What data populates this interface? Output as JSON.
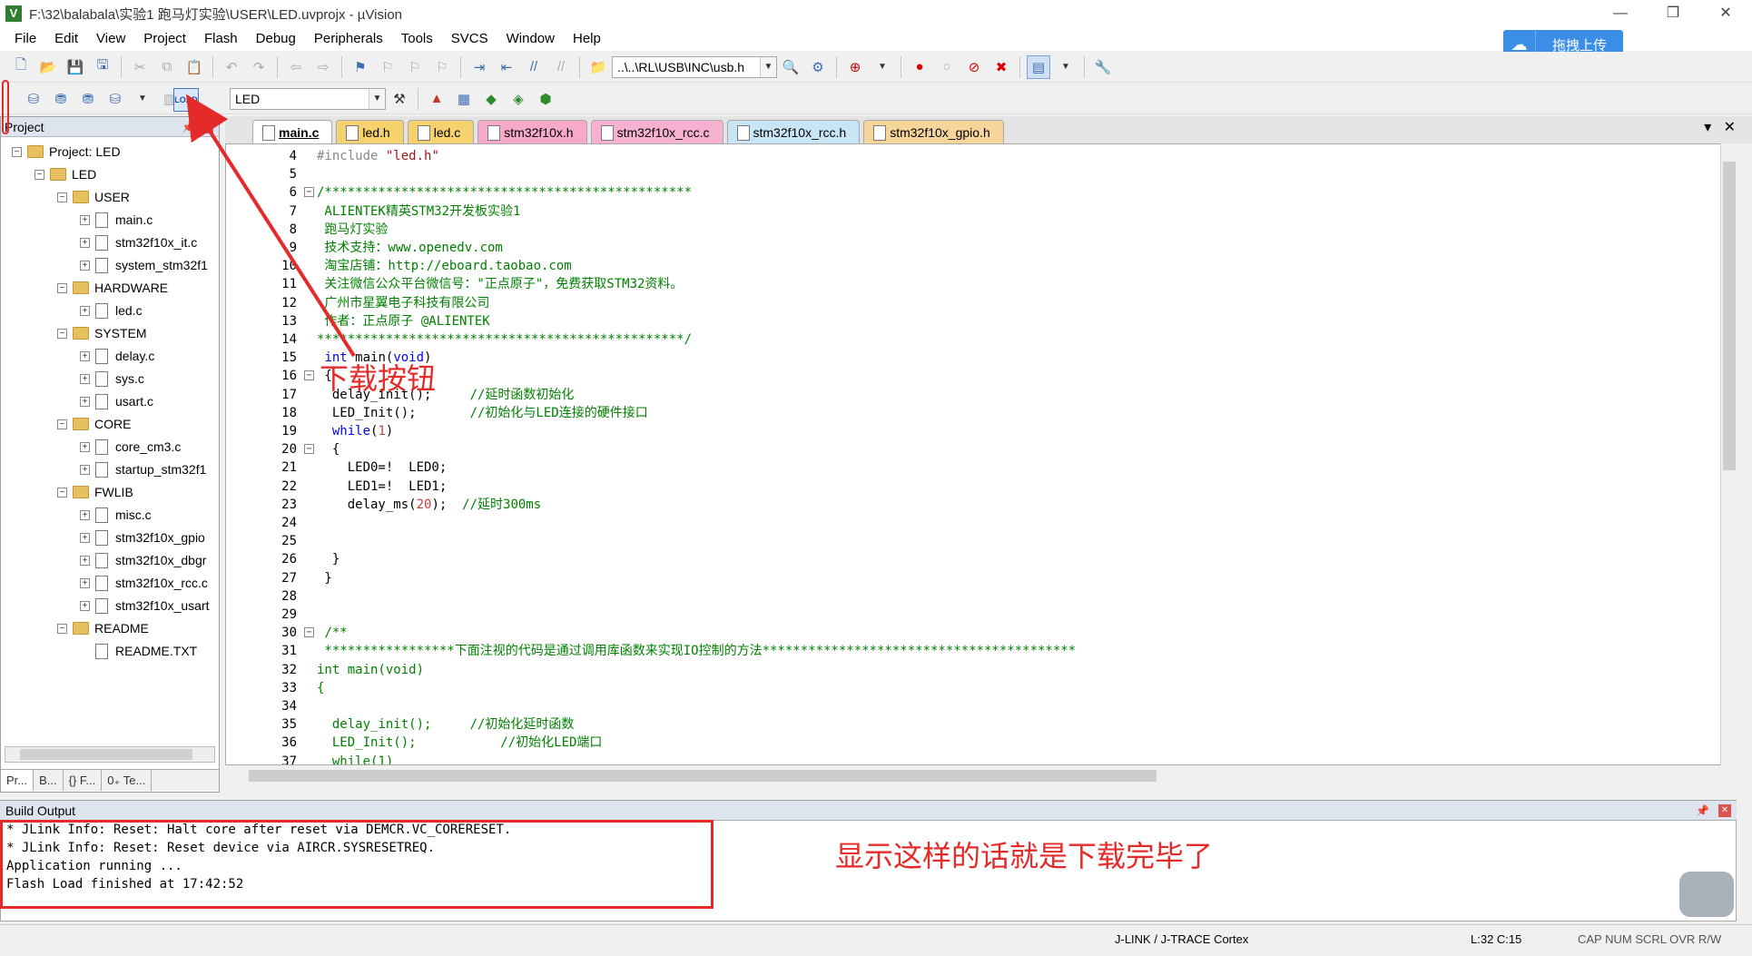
{
  "window": {
    "title": "F:\\32\\balabala\\实验1 跑马灯实验\\USER\\LED.uvprojx - µVision",
    "controls": [
      "—",
      "❐",
      "✕"
    ]
  },
  "menu": [
    "File",
    "Edit",
    "View",
    "Project",
    "Flash",
    "Debug",
    "Peripherals",
    "Tools",
    "SVCS",
    "Window",
    "Help"
  ],
  "cloud_upload": {
    "label": "拖拽上传"
  },
  "toolbar": {
    "file_combo": "..\\..\\RL\\USB\\INC\\usb.h",
    "target_combo": "LED",
    "load_label": "LOAD"
  },
  "project_panel": {
    "title": "Project",
    "tree": [
      {
        "label": "Project: LED",
        "level": 0,
        "type": "root"
      },
      {
        "label": "LED",
        "level": 1,
        "type": "target"
      },
      {
        "label": "USER",
        "level": 2,
        "type": "folder"
      },
      {
        "label": "main.c",
        "level": 3,
        "type": "file"
      },
      {
        "label": "stm32f10x_it.c",
        "level": 3,
        "type": "file"
      },
      {
        "label": "system_stm32f1",
        "level": 3,
        "type": "file"
      },
      {
        "label": "HARDWARE",
        "level": 2,
        "type": "folder"
      },
      {
        "label": "led.c",
        "level": 3,
        "type": "file"
      },
      {
        "label": "SYSTEM",
        "level": 2,
        "type": "folder"
      },
      {
        "label": "delay.c",
        "level": 3,
        "type": "file"
      },
      {
        "label": "sys.c",
        "level": 3,
        "type": "file"
      },
      {
        "label": "usart.c",
        "level": 3,
        "type": "file"
      },
      {
        "label": "CORE",
        "level": 2,
        "type": "folder"
      },
      {
        "label": "core_cm3.c",
        "level": 3,
        "type": "file"
      },
      {
        "label": "startup_stm32f1",
        "level": 3,
        "type": "file"
      },
      {
        "label": "FWLIB",
        "level": 2,
        "type": "folder"
      },
      {
        "label": "misc.c",
        "level": 3,
        "type": "file"
      },
      {
        "label": "stm32f10x_gpio",
        "level": 3,
        "type": "file"
      },
      {
        "label": "stm32f10x_dbgr",
        "level": 3,
        "type": "file"
      },
      {
        "label": "stm32f10x_rcc.c",
        "level": 3,
        "type": "file"
      },
      {
        "label": "stm32f10x_usart",
        "level": 3,
        "type": "file"
      },
      {
        "label": "README",
        "level": 2,
        "type": "folder"
      },
      {
        "label": "README.TXT",
        "level": 3,
        "type": "file"
      }
    ],
    "tabs": [
      "Pr...",
      "B...",
      "{} F...",
      "0₊ Te..."
    ]
  },
  "editor_tabs": [
    {
      "label": "main.c",
      "active": true,
      "color": ""
    },
    {
      "label": "led.h",
      "active": false,
      "color": "#f5d26d"
    },
    {
      "label": "led.c",
      "active": false,
      "color": "#f5d26d"
    },
    {
      "label": "stm32f10x.h",
      "active": false,
      "color": "#f7a9c9"
    },
    {
      "label": "stm32f10x_rcc.c",
      "active": false,
      "color": "#f7b1d0"
    },
    {
      "label": "stm32f10x_rcc.h",
      "active": false,
      "color": "#c8e5f5"
    },
    {
      "label": "stm32f10x_gpio.h",
      "active": false,
      "color": "#f5d59a"
    }
  ],
  "code_lines": [
    {
      "n": "4",
      "fold": "",
      "html": "<span class=\"pp\">#include</span> <span class=\"str\">\"led.h\"</span>"
    },
    {
      "n": "5",
      "fold": "",
      "html": ""
    },
    {
      "n": "6",
      "fold": "-",
      "html": "<span class=\"cm\">/************************************************</span>"
    },
    {
      "n": "7",
      "fold": "",
      "html": "<span class=\"cm\"> ALIENTEK精英STM32开发板实验1</span>"
    },
    {
      "n": "8",
      "fold": "",
      "html": "<span class=\"cm\"> 跑马灯实验</span>"
    },
    {
      "n": "9",
      "fold": "",
      "html": "<span class=\"cm\"> 技术支持：www.openedv.com</span>"
    },
    {
      "n": "10",
      "fold": "",
      "html": "<span class=\"cm\"> 淘宝店铺：http://eboard.taobao.com</span>"
    },
    {
      "n": "11",
      "fold": "",
      "html": "<span class=\"cm\"> 关注微信公众平台微信号：\"正点原子\"，免费获取STM32资料。</span>"
    },
    {
      "n": "12",
      "fold": "",
      "html": "<span class=\"cm\"> 广州市星翼电子科技有限公司</span>"
    },
    {
      "n": "13",
      "fold": "",
      "html": "<span class=\"cm\"> 作者：正点原子 @ALIENTEK</span>"
    },
    {
      "n": "14",
      "fold": "",
      "html": "<span class=\"cm\">************************************************/</span>"
    },
    {
      "n": "15",
      "fold": "",
      "html": " <span class=\"kw\">int</span> main(<span class=\"kw\">void</span>)"
    },
    {
      "n": "16",
      "fold": "-",
      "html": " {"
    },
    {
      "n": "17",
      "fold": "",
      "html": "  delay_init();     <span class=\"cm\">//延时函数初始化</span>"
    },
    {
      "n": "18",
      "fold": "",
      "html": "  LED_Init();       <span class=\"cm\">//初始化与LED连接的硬件接口</span>"
    },
    {
      "n": "19",
      "fold": "",
      "html": "  <span class=\"kw\">while</span>(<span class=\"num\">1</span>)"
    },
    {
      "n": "20",
      "fold": "-",
      "html": "  {"
    },
    {
      "n": "21",
      "fold": "",
      "html": "    LED0=!  LED0;"
    },
    {
      "n": "22",
      "fold": "",
      "html": "    LED1=!  LED1;"
    },
    {
      "n": "23",
      "fold": "",
      "html": "    delay_ms(<span class=\"num\">20</span>);  <span class=\"cm\">//延时300ms</span>"
    },
    {
      "n": "24",
      "fold": "",
      "html": ""
    },
    {
      "n": "25",
      "fold": "",
      "html": ""
    },
    {
      "n": "26",
      "fold": "",
      "html": "  }"
    },
    {
      "n": "27",
      "fold": "",
      "html": " }"
    },
    {
      "n": "28",
      "fold": "",
      "html": ""
    },
    {
      "n": "29",
      "fold": "",
      "html": ""
    },
    {
      "n": "30",
      "fold": "-",
      "html": " <span class=\"cm\">/**</span>"
    },
    {
      "n": "31",
      "fold": "",
      "html": "<span class=\"cm\"> *****************下面注视的代码是通过调用库函数来实现IO控制的方法*****************************************</span>"
    },
    {
      "n": "32",
      "fold": "",
      "html": "<span class=\"cm\">int main(void)</span>"
    },
    {
      "n": "33",
      "fold": "",
      "html": "<span class=\"cm\">{</span>"
    },
    {
      "n": "34",
      "fold": "",
      "html": ""
    },
    {
      "n": "35",
      "fold": "",
      "html": "<span class=\"cm\">  delay_init();     //初始化延时函数</span>"
    },
    {
      "n": "36",
      "fold": "",
      "html": "<span class=\"cm\">  LED_Init();           //初始化LED端口</span>"
    },
    {
      "n": "37",
      "fold": "",
      "html": "<span class=\"cm\">  while(1)</span>"
    }
  ],
  "build_output": {
    "title": "Build Output",
    "lines": [
      "* JLink Info: Reset: Halt core after reset via DEMCR.VC_CORERESET.",
      "* JLink Info: Reset: Reset device via AIRCR.SYSRESETREQ.",
      "Application running ...",
      "Flash Load finished at 17:42:52"
    ]
  },
  "annotations": {
    "download_button": "下载按钮",
    "download_done": "显示这样的话就是下载完毕了"
  },
  "statusbar": {
    "debugger": "J-LINK / J-TRACE Cortex",
    "position": "L:32 C:15",
    "flags": "CAP  NUM  SCRL  OVR  R/W"
  }
}
